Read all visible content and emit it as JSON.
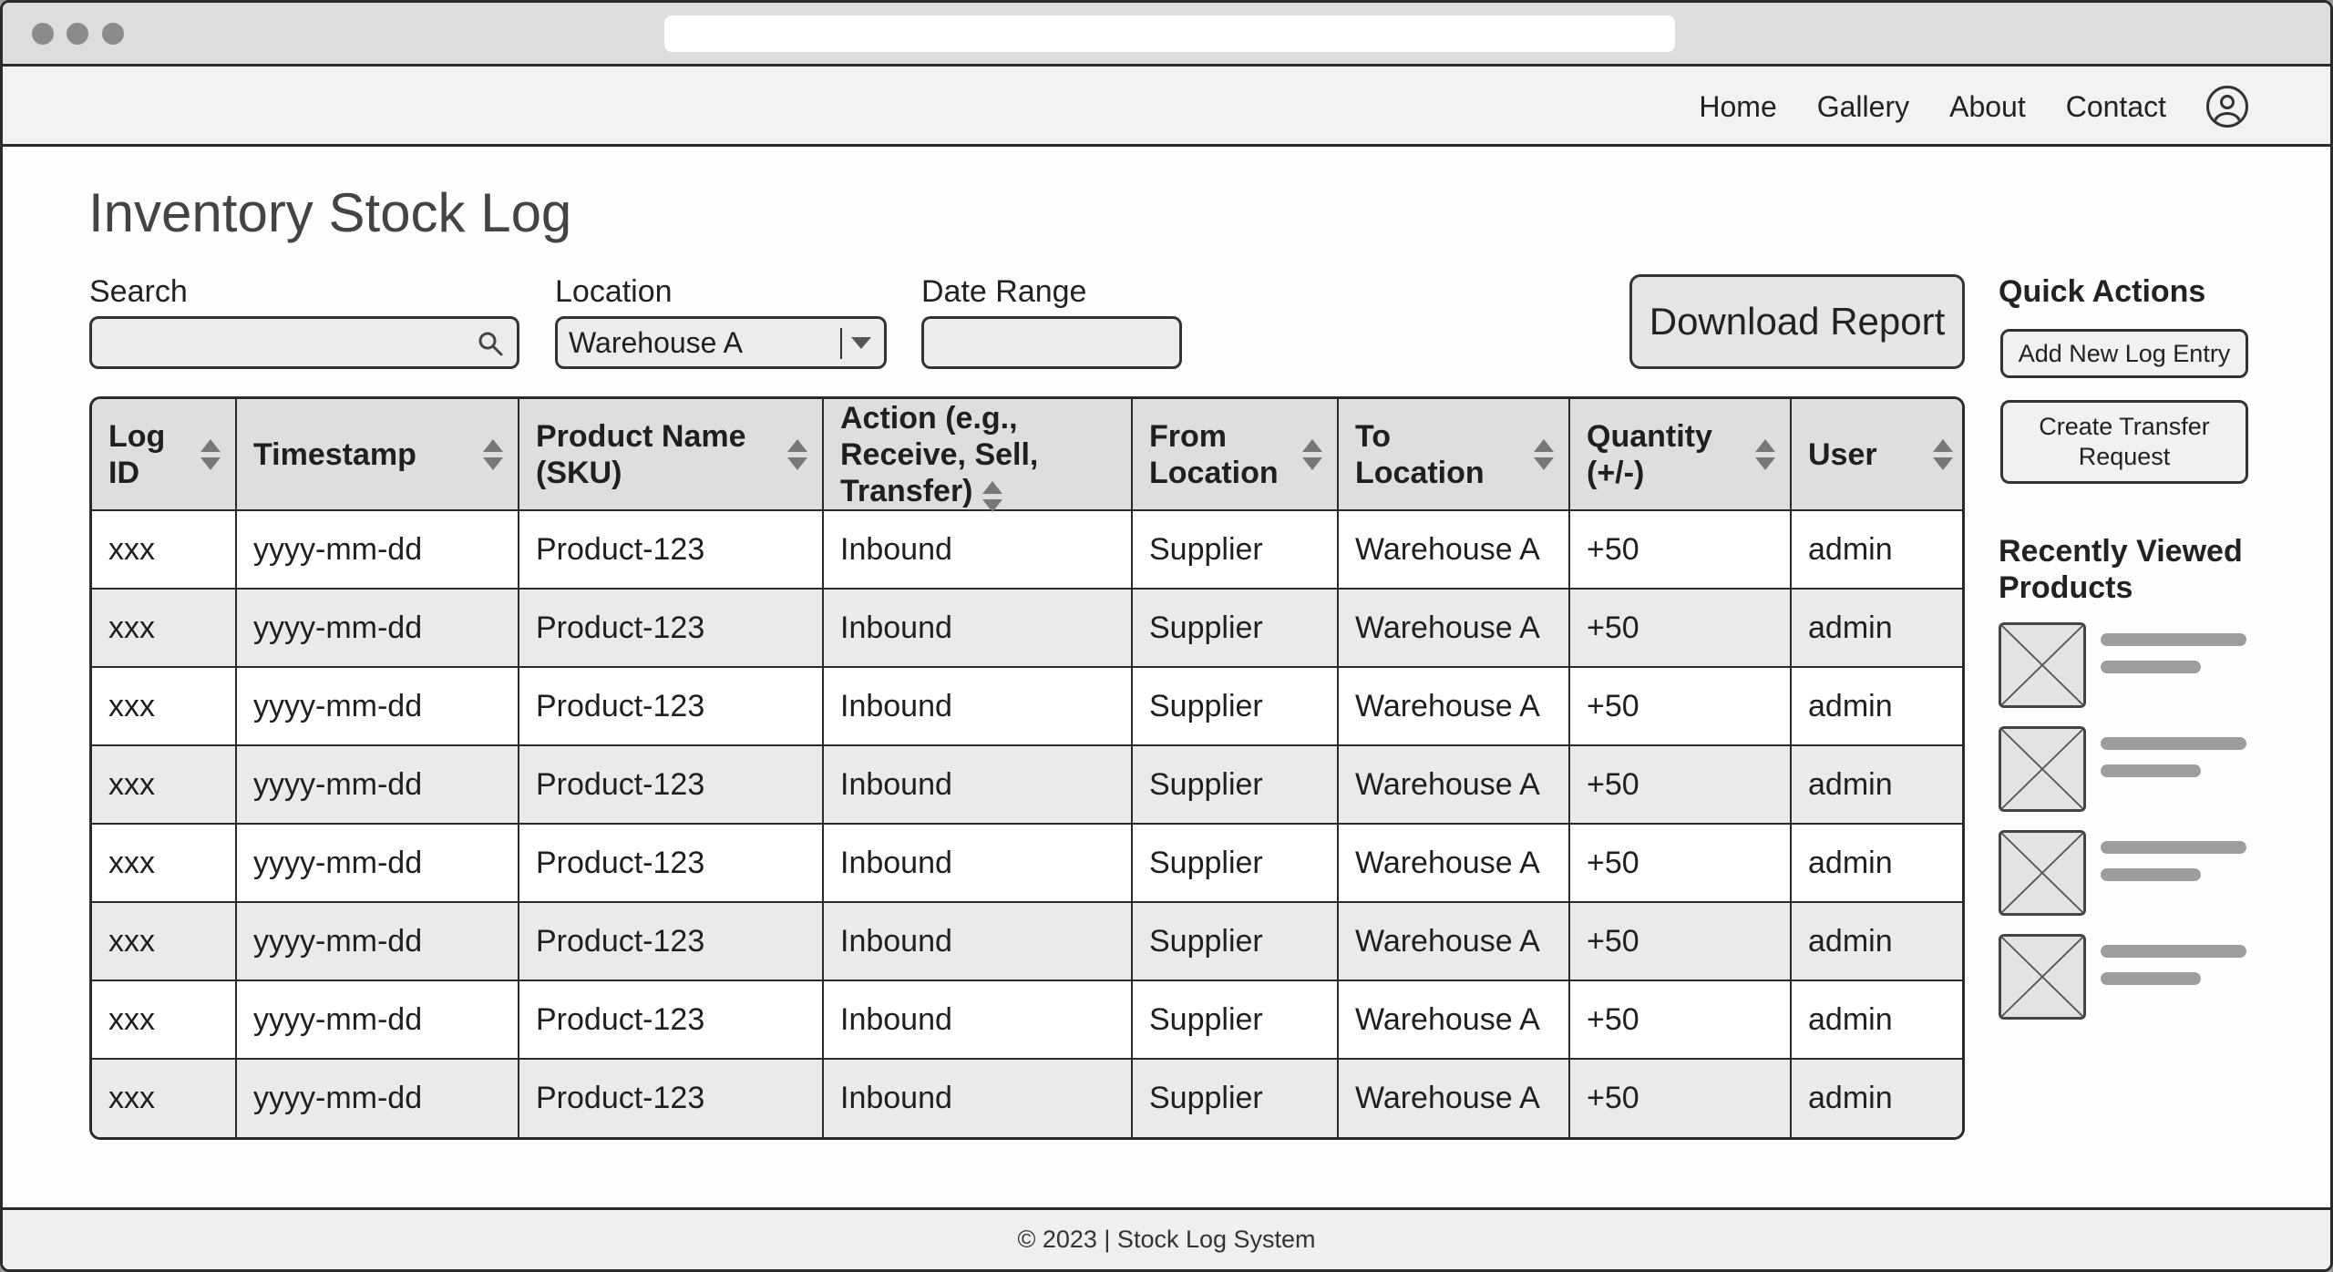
{
  "nav": {
    "links": [
      "Home",
      "Gallery",
      "About",
      "Contact"
    ]
  },
  "page": {
    "title": "Inventory Stock Log"
  },
  "filters": {
    "search_label": "Search",
    "location_label": "Location",
    "location_value": "Warehouse A",
    "date_range_label": "Date Range"
  },
  "toolbar": {
    "download_label": "Download Report"
  },
  "table": {
    "columns": [
      "Log ID",
      "Timestamp",
      "Product Name (SKU)",
      "Action (e.g., Receive, Sell, Transfer)",
      "From Location",
      "To Location",
      "Quantity (+/-)",
      "User"
    ],
    "rows": [
      [
        "xxx",
        "yyyy-mm-dd",
        "Product-123",
        "Inbound",
        "Supplier",
        "Warehouse A",
        "+50",
        "admin"
      ],
      [
        "xxx",
        "yyyy-mm-dd",
        "Product-123",
        "Inbound",
        "Supplier",
        "Warehouse A",
        "+50",
        "admin"
      ],
      [
        "xxx",
        "yyyy-mm-dd",
        "Product-123",
        "Inbound",
        "Supplier",
        "Warehouse A",
        "+50",
        "admin"
      ],
      [
        "xxx",
        "yyyy-mm-dd",
        "Product-123",
        "Inbound",
        "Supplier",
        "Warehouse A",
        "+50",
        "admin"
      ],
      [
        "xxx",
        "yyyy-mm-dd",
        "Product-123",
        "Inbound",
        "Supplier",
        "Warehouse A",
        "+50",
        "admin"
      ],
      [
        "xxx",
        "yyyy-mm-dd",
        "Product-123",
        "Inbound",
        "Supplier",
        "Warehouse A",
        "+50",
        "admin"
      ],
      [
        "xxx",
        "yyyy-mm-dd",
        "Product-123",
        "Inbound",
        "Supplier",
        "Warehouse A",
        "+50",
        "admin"
      ],
      [
        "xxx",
        "yyyy-mm-dd",
        "Product-123",
        "Inbound",
        "Supplier",
        "Warehouse A",
        "+50",
        "admin"
      ]
    ]
  },
  "sidebar": {
    "quick_actions_title": "Quick Actions",
    "add_entry_label": "Add New Log Entry",
    "transfer_label": "Create Transfer Request",
    "recently_viewed_title": "Recently Viewed Products",
    "recent_items_count": 4
  },
  "footer": {
    "text": "© 2023 | Stock Log System"
  },
  "icons": {
    "search": "search-icon",
    "dropdown": "chevron-down-icon",
    "sort": "sort-icon",
    "user": "user-avatar-icon",
    "image_placeholder": "image-placeholder-icon"
  }
}
